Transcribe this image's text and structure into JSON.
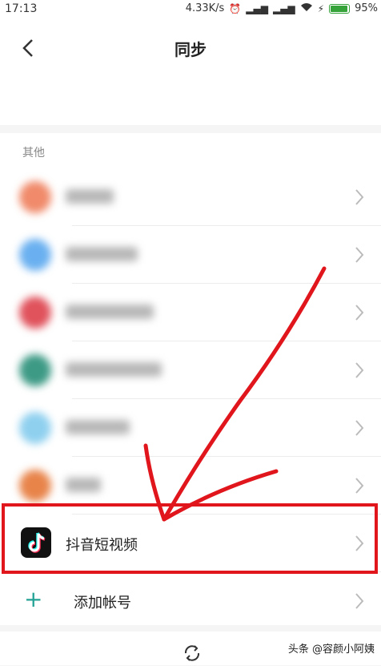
{
  "status_bar": {
    "time": "17:13",
    "speed": "4.33K/s",
    "battery": "95%",
    "battery_level": 0.95,
    "icons": [
      "alarm-icon",
      "signal-icon",
      "signal-icon",
      "wifi-icon",
      "charging-icon",
      "battery-icon"
    ]
  },
  "header": {
    "title": "同步",
    "back_icon": "back-arrow-icon"
  },
  "section": {
    "label": "其他"
  },
  "accounts": [
    {
      "label": "Office",
      "icon_color": "#f08a6a",
      "blurred": true
    },
    {
      "label": "云文档同步",
      "icon_color": "#6ab0f0",
      "blurred": true
    },
    {
      "label": "日历同步服务",
      "icon_color": "#e0525c",
      "blurred": true
    },
    {
      "label": "android_sync",
      "icon_color": "#3d9a85",
      "blurred": true
    },
    {
      "label": "万能钥匙",
      "icon_color": "#8fd0ef",
      "blurred": true
    },
    {
      "label": "相册",
      "icon_color": "#e8844a",
      "blurred": true
    },
    {
      "label": "抖音短视频",
      "icon": "tiktok-icon",
      "blurred": false
    }
  ],
  "add_account": {
    "label": "添加帐号",
    "icon": "plus-icon"
  },
  "bottom": {
    "sync_icon": "sync-icon",
    "watermark": "头条 @容颜小阿姨"
  },
  "annotation_color": "#e0161c"
}
